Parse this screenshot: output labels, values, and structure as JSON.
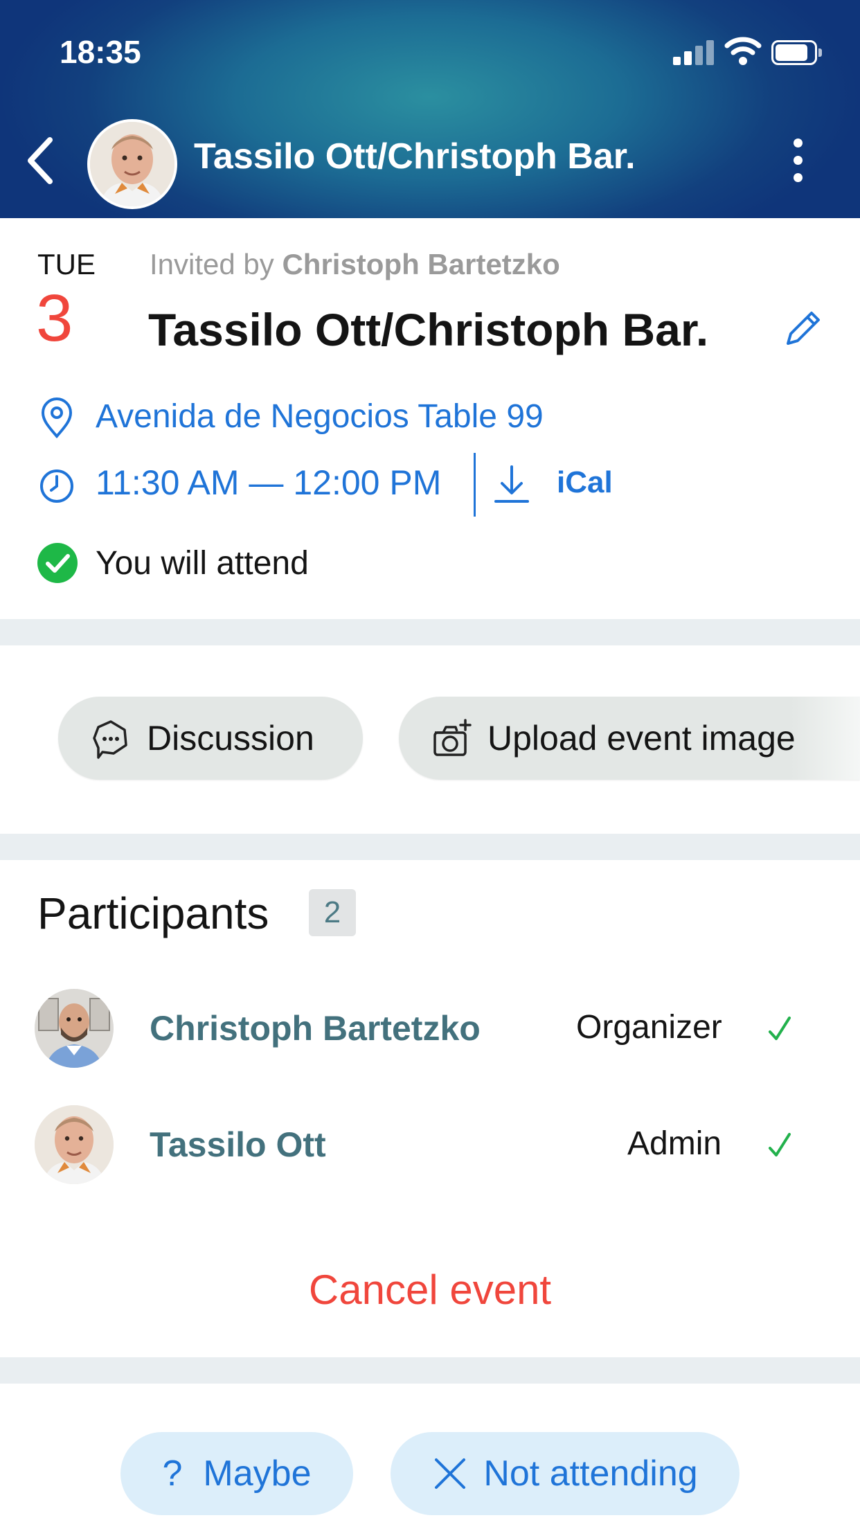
{
  "status_bar": {
    "time": "18:35"
  },
  "nav": {
    "title": "Tassilo Ott/Christoph Bar.",
    "back_icon": "chevron-left-icon",
    "menu_icon": "kebab-menu-icon"
  },
  "event": {
    "weekday": "TUE",
    "day": "3",
    "invited_prefix": "Invited by",
    "invited_by": "Christoph Bartetzko",
    "title": "Tassilo Ott/Christoph Bar.",
    "location": "Avenida de Negocios Table 99",
    "time_range": "11:30 AM — 12:00 PM",
    "ical_label": "iCal",
    "attendance_status": "You will attend"
  },
  "actions": {
    "discussion_label": "Discussion",
    "upload_label": "Upload event image"
  },
  "participants": {
    "heading": "Participants",
    "count": "2",
    "items": [
      {
        "name": "Christoph Bartetzko",
        "role": "Organizer"
      },
      {
        "name": "Tassilo Ott",
        "role": "Admin"
      }
    ]
  },
  "cancel_label": "Cancel event",
  "rsvp": {
    "maybe_icon": "?",
    "maybe_label": "Maybe",
    "not_attending_label": "Not attending"
  },
  "colors": {
    "accent_blue": "#1f74d8",
    "danger_red": "#f0463c",
    "success_green": "#1eb847",
    "participant_name": "#43717d"
  }
}
